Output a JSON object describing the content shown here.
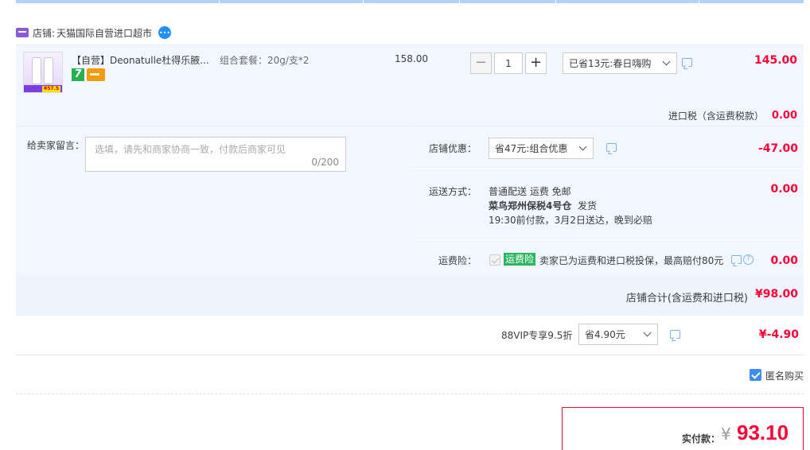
{
  "shop": {
    "label": "店铺:",
    "name": "天猫国际自营进口超市"
  },
  "item": {
    "title": "【自营】Deonatulle杜得乐腋...",
    "sku": "组合套餐：20g/支*2",
    "unit_price": "158.00",
    "quantity": "1",
    "qty_minus": "−",
    "qty_plus": "+",
    "promo_select": "已省13元:春日嗨购",
    "subtotal": "145.00",
    "thumb_price": "¥57.5",
    "badge_text": "7"
  },
  "tax": {
    "label": "进口税（含运费税款）",
    "value": "0.00"
  },
  "message": {
    "label": "给卖家留言：",
    "placeholder": "选填，请先和商家协商一致，付款后商家可见",
    "count": "0/200"
  },
  "shop_discount": {
    "label": "店铺优惠：",
    "select": "省47元:组合优惠",
    "value": "-47.00"
  },
  "shipping": {
    "label": "运送方式：",
    "line1": "普通配送 运费 免邮",
    "line2_bold": "菜鸟郑州保税4号仓",
    "line2_rest": "  发货",
    "line3": "19:30前付款，3月2日送达，晚到必赔",
    "value": "0.00"
  },
  "insurance": {
    "label": "运费险：",
    "tag": "运费险",
    "text": "卖家已为运费和进口税投保，最高赔付80元",
    "value": "0.00"
  },
  "shop_total": {
    "label": "店铺合计(含运费和进口税)",
    "value": "¥98.00"
  },
  "vip": {
    "label": "88VIP专享9.5折",
    "select": "省4.90元",
    "value": "¥-4.90"
  },
  "anonymous": {
    "label": "匿名购买",
    "checked": true
  },
  "payment": {
    "label": "实付款：",
    "yen": "¥",
    "value": "93.10"
  },
  "colors": {
    "accent_red": "#ff0036",
    "panel_bg": "#f2f7ff",
    "checkbox_blue": "#3d8ef0",
    "tag_green": "#2cb55e",
    "shop_icon_purple": "#8b5bd6"
  }
}
